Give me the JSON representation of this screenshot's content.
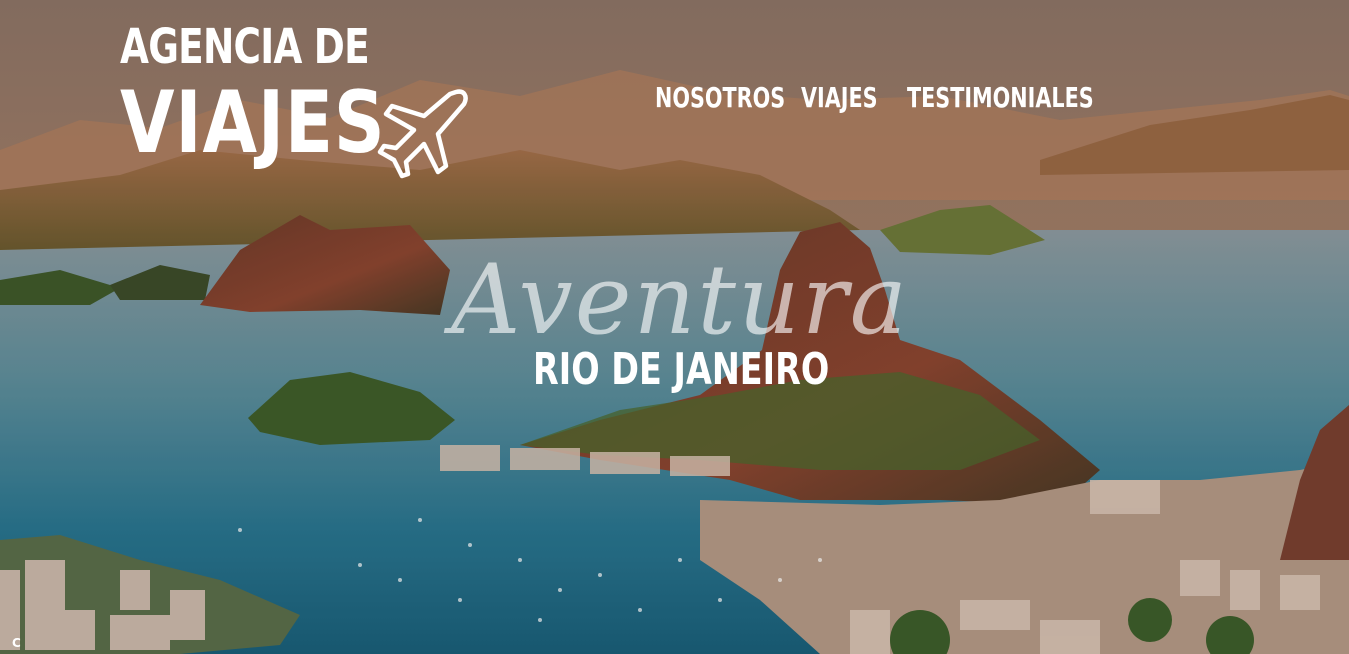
{
  "brand": {
    "line1": "AGENCIA DE",
    "line2": "VIAJES",
    "icon": "airplane-icon"
  },
  "nav": {
    "items": [
      {
        "label": "NOSOTROS"
      },
      {
        "label": "VIAJES"
      },
      {
        "label": "TESTIMONIALES"
      }
    ]
  },
  "hero": {
    "tagline": "Aventura",
    "city": "RIO DE JANEIRO",
    "background": "aerial view of coastal bay with mountains at sunset"
  },
  "corner_badge": "C",
  "colors": {
    "text": "#ffffff",
    "sky": "#8d7466",
    "water": "#1f6b86"
  }
}
